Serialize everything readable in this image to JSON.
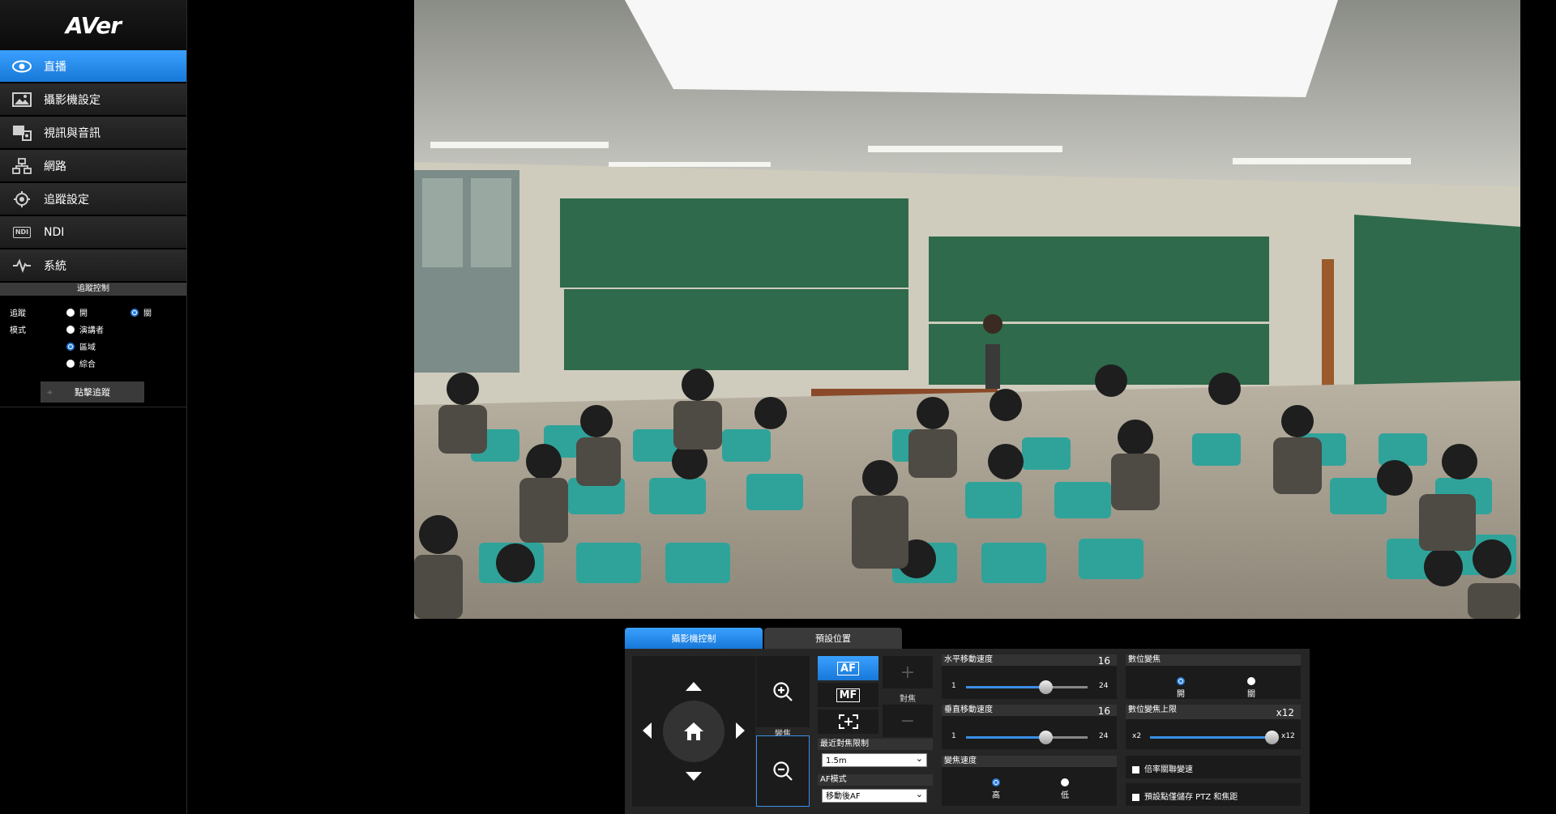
{
  "brand": {
    "logo": "AVer"
  },
  "sidebar": {
    "items": [
      {
        "label": "直播",
        "icon": "eye-icon",
        "active": true
      },
      {
        "label": "攝影機設定",
        "icon": "image-icon"
      },
      {
        "label": "視訊與音訊",
        "icon": "av-icon"
      },
      {
        "label": "網路",
        "icon": "network-icon"
      },
      {
        "label": "追蹤設定",
        "icon": "target-icon"
      },
      {
        "label": "NDI",
        "icon": "ndi-icon",
        "icon_text": "NDI"
      },
      {
        "label": "系統",
        "icon": "pulse-icon"
      }
    ]
  },
  "tracking": {
    "header": "追蹤控制",
    "tracking_label": "追蹤",
    "on_label": "開",
    "off_label": "關",
    "tracking_state": "off",
    "mode_label": "模式",
    "modes": [
      "演講者",
      "區域",
      "綜合"
    ],
    "selected_mode": "區域",
    "click_track_label": "點擊追蹤"
  },
  "tabs": [
    {
      "label": "攝影機控制",
      "active": true
    },
    {
      "label": "預設位置",
      "active": false
    }
  ],
  "controls": {
    "zoom_label": "變焦",
    "focus_label": "對焦",
    "af_label": "AF",
    "mf_label": "MF",
    "plus": "+",
    "minus": "−",
    "min_focus_label": "最近對焦限制",
    "min_focus_value": "1.5m",
    "af_mode_label": "AF模式",
    "af_mode_value": "移動後AF",
    "pan_speed": {
      "label": "水平移動速度",
      "value": "16",
      "min": "1",
      "max": "24",
      "fraction": 0.65
    },
    "tilt_speed": {
      "label": "垂直移動速度",
      "value": "16",
      "min": "1",
      "max": "24",
      "fraction": 0.65
    },
    "zoom_speed": {
      "label": "變焦速度",
      "high": "高",
      "low": "低",
      "selected": "high"
    },
    "digital_zoom": {
      "label": "數位變焦",
      "on": "開",
      "off": "關",
      "selected": "on"
    },
    "dz_limit": {
      "label": "數位變焦上限",
      "value": "x12",
      "min": "x2",
      "max": "x12",
      "fraction": 1.0
    },
    "zoom_ratio_speed_label": "倍率關聯變速",
    "preset_save_label": "預設點僅儲存 PTZ 和焦距"
  },
  "colors": {
    "accent": "#1e88e5",
    "panel": "#262626"
  }
}
